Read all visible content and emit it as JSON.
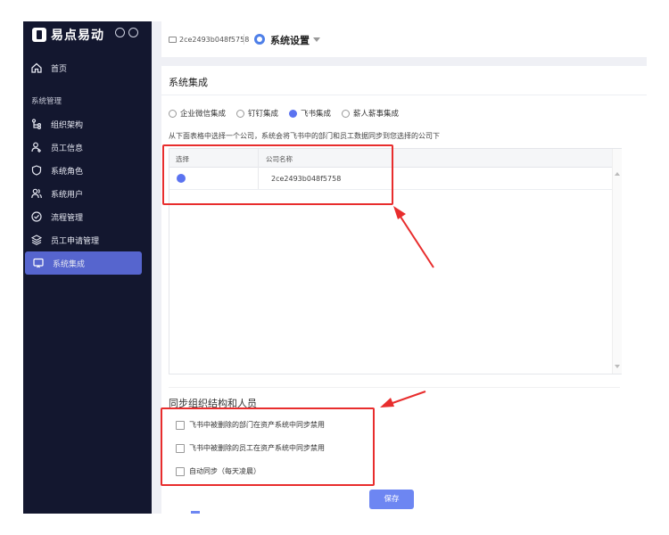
{
  "app": {
    "logo_text": "易点易动"
  },
  "sidebar": {
    "home_label": "首页",
    "section_label": "系统管理",
    "items": [
      {
        "label": "组织架构"
      },
      {
        "label": "员工信息"
      },
      {
        "label": "系统角色"
      },
      {
        "label": "系统用户"
      },
      {
        "label": "流程管理"
      },
      {
        "label": "员工申请管理"
      },
      {
        "label": "系统集成"
      }
    ],
    "active_index": 6
  },
  "header": {
    "device_id": "2ce2493b048f5758",
    "title": "系统设置"
  },
  "main": {
    "title": "系统集成",
    "tabs": [
      {
        "label": "企业微信集成",
        "selected": false
      },
      {
        "label": "钉钉集成",
        "selected": false
      },
      {
        "label": "飞书集成",
        "selected": true
      },
      {
        "label": "薪人薪事集成",
        "selected": false
      }
    ],
    "instruction": "从下面表格中选择一个公司，系统会将飞书中的部门和员工数据同步到您选择的公司下",
    "table": {
      "headers": [
        "选择",
        "公司名称"
      ],
      "rows": [
        {
          "selected": true,
          "company": "2ce2493b048f5758"
        }
      ]
    },
    "sync": {
      "title": "同步组织结构和人员",
      "options": [
        {
          "label": "飞书中被删除的部门在资产系统中同步禁用",
          "checked": false
        },
        {
          "label": "飞书中被删除的员工在资产系统中同步禁用",
          "checked": false
        },
        {
          "label": "自动同步（每天凌晨）",
          "checked": false
        }
      ]
    },
    "save_label": "保存"
  },
  "colors": {
    "accent": "#5b73f0",
    "sidebar_bg": "#13172f",
    "annotation": "#e82d2d"
  }
}
